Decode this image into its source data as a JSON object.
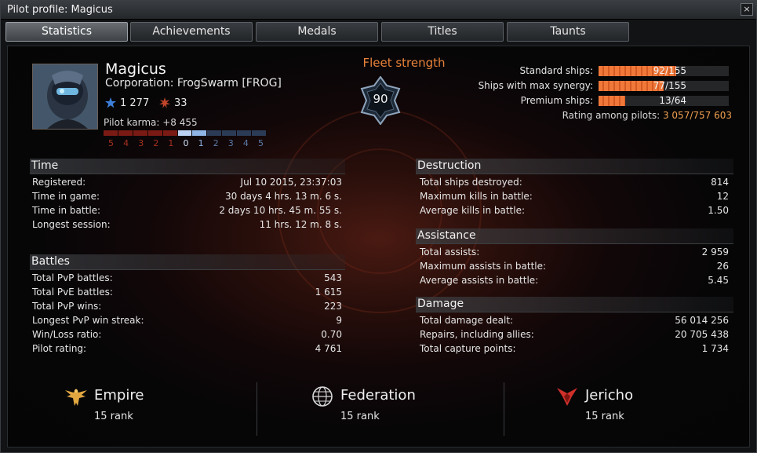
{
  "window": {
    "title": "Pilot profile: Magicus",
    "close_icon": "×"
  },
  "tabs": [
    {
      "label": "Statistics",
      "active": true
    },
    {
      "label": "Achievements",
      "active": false
    },
    {
      "label": "Medals",
      "active": false
    },
    {
      "label": "Titles",
      "active": false
    },
    {
      "label": "Taunts",
      "active": false
    }
  ],
  "pilot": {
    "name": "Magicus",
    "corporation": "Corporation: FrogSwarm [FROG]",
    "rating_stat": "1 277",
    "kills_stat": "33",
    "karma_label": "Pilot karma: +8 455",
    "karma_scale": [
      "5",
      "4",
      "3",
      "2",
      "1",
      "0",
      "1",
      "2",
      "3",
      "4",
      "5"
    ],
    "karma_level_fraction": 0.55
  },
  "fleet": {
    "label": "Fleet strength",
    "value": "90"
  },
  "ships": [
    {
      "label": "Standard ships:",
      "value": "92/155",
      "fraction": 0.594
    },
    {
      "label": "Ships with max synergy:",
      "value": "77/155",
      "fraction": 0.497
    },
    {
      "label": "Premium ships:",
      "value": "13/64",
      "fraction": 0.203
    }
  ],
  "rating": {
    "label": "Rating among pilots:",
    "value": "3 057",
    "total": "/757 603"
  },
  "time": {
    "title": "Time",
    "rows": [
      {
        "label": "Registered:",
        "value": "Jul 10 2015, 23:37:03"
      },
      {
        "label": "Time in game:",
        "value": "30 days 4 hrs. 13 m. 6 s."
      },
      {
        "label": "Time in battle:",
        "value": "2 days 10 hrs. 45 m. 55 s."
      },
      {
        "label": "Longest session:",
        "value": "11 hrs. 12 m. 8 s."
      }
    ]
  },
  "battles": {
    "title": "Battles",
    "rows": [
      {
        "label": "Total PvP battles:",
        "value": "543"
      },
      {
        "label": "Total PvE battles:",
        "value": "1 615"
      },
      {
        "label": "Total PvP wins:",
        "value": "223"
      },
      {
        "label": "Longest PvP win streak:",
        "value": "9"
      },
      {
        "label": "Win/Loss ratio:",
        "value": "0.70"
      },
      {
        "label": "Pilot rating:",
        "value": "4 761"
      }
    ]
  },
  "destruction": {
    "title": "Destruction",
    "rows": [
      {
        "label": "Total ships destroyed:",
        "value": "814"
      },
      {
        "label": "Maximum kills in battle:",
        "value": "12"
      },
      {
        "label": "Average kills in battle:",
        "value": "1.50"
      }
    ]
  },
  "assistance": {
    "title": "Assistance",
    "rows": [
      {
        "label": "Total assists:",
        "value": "2 959"
      },
      {
        "label": "Maximum assists in battle:",
        "value": "26"
      },
      {
        "label": "Average assists in battle:",
        "value": "5.45"
      }
    ]
  },
  "damage": {
    "title": "Damage",
    "rows": [
      {
        "label": "Total damage dealt:",
        "value": "56 014 256"
      },
      {
        "label": "Repairs, including allies:",
        "value": "20 705 438"
      },
      {
        "label": "Total capture points:",
        "value": "1 734"
      }
    ]
  },
  "factions": [
    {
      "name": "Empire",
      "rank": "15 rank",
      "icon": "empire-eagle-icon"
    },
    {
      "name": "Federation",
      "rank": "15 rank",
      "icon": "federation-globe-icon"
    },
    {
      "name": "Jericho",
      "rank": "15 rank",
      "icon": "jericho-emblem-icon"
    }
  ],
  "colors": {
    "accent": "#e8823a",
    "bar_fill": "#f0793a",
    "karma_negative": "#7a1a14",
    "karma_positive": "#8fb4e6"
  }
}
